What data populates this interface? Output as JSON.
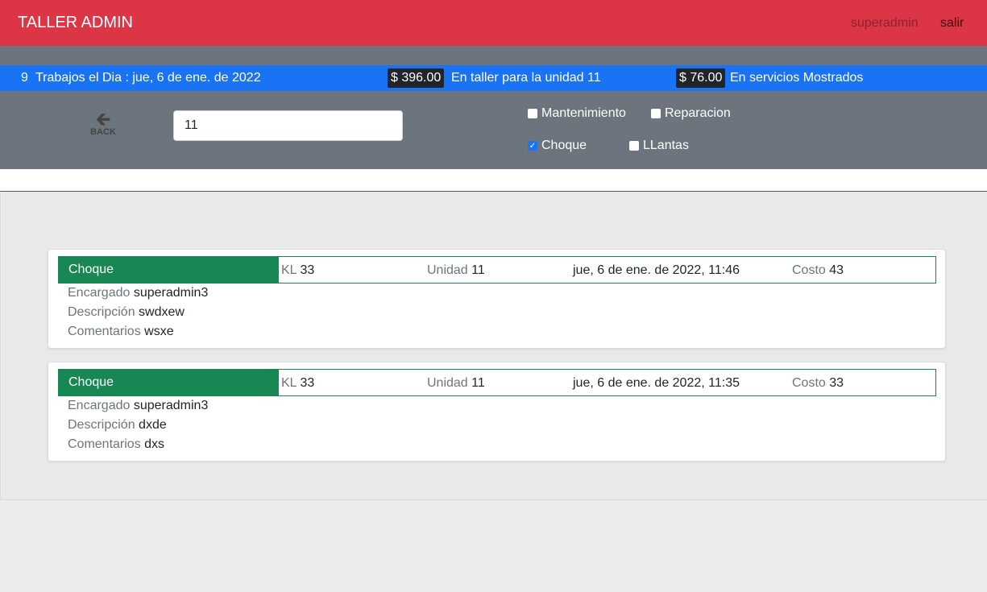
{
  "navbar": {
    "brand": "TALLER ADMIN",
    "user": "superadmin",
    "logout": "salir",
    "color": "#dc3545"
  },
  "summary": {
    "count": "9",
    "day_text": "Trabajos el Dia : jue, 6 de ene. de 2022",
    "taller_amount": "$ 396.00",
    "taller_text": "En taller para la unidad 11",
    "servicios_amount": "$ 76.00",
    "servicios_text": "En servicios Mostrados",
    "color": "#1a73f5"
  },
  "filters": {
    "back_label": "BACK",
    "search_value": "11",
    "checkboxes": [
      {
        "label": "Mantenimiento",
        "checked": false
      },
      {
        "label": "Reparacion",
        "checked": false
      },
      {
        "label": "Choque",
        "checked": true
      },
      {
        "label": "LLantas",
        "checked": false
      }
    ]
  },
  "labels": {
    "kl": "KL",
    "unidad": "Unidad",
    "costo": "Costo",
    "encargado": "Encargado",
    "descripcion": "Descripción",
    "comentarios": "Comentarios"
  },
  "jobs": [
    {
      "type": "Choque",
      "kl": "33",
      "unidad": "11",
      "fecha": "jue, 6 de ene. de 2022, 11:46",
      "costo": "43",
      "encargado": "superadmin3",
      "descripcion": "swdxew",
      "comentarios": "wsxe"
    },
    {
      "type": "Choque",
      "kl": "33",
      "unidad": "11",
      "fecha": "jue, 6 de ene. de 2022, 11:35",
      "costo": "33",
      "encargado": "superadmin3",
      "descripcion": "dxde",
      "comentarios": "dxs"
    }
  ]
}
